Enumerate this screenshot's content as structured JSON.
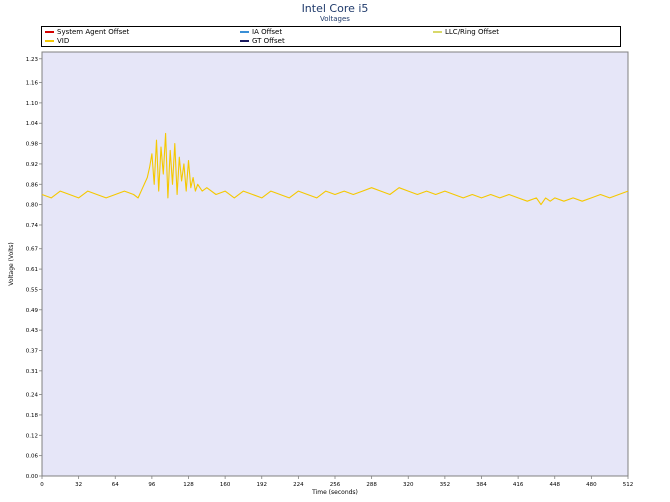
{
  "title": "Intel Core i5",
  "subtitle": "Voltages",
  "legend": [
    {
      "name": "System Agent Offset",
      "color": "#d40000"
    },
    {
      "name": "IA Offset",
      "color": "#3a8fd6"
    },
    {
      "name": "LLC/Ring Offset",
      "color": "#d8d86a"
    },
    {
      "name": "VID",
      "color": "#f5c800"
    },
    {
      "name": "GT Offset",
      "color": "#1a1a5e"
    }
  ],
  "chart_data": {
    "type": "line",
    "title": "Intel Core i5",
    "subtitle": "Voltages",
    "xlabel": "Time (seconds)",
    "ylabel": "Voltage (Volts)",
    "xlim": [
      0,
      512
    ],
    "ylim": [
      0,
      1.25
    ],
    "grid": false,
    "legend_position": "top",
    "xticks": [
      "0",
      "32",
      "64",
      "96",
      "128",
      "160",
      "192",
      "224",
      "256",
      "288",
      "320",
      "352",
      "384",
      "416",
      "448",
      "480",
      "512"
    ],
    "yticks": [
      "0.00",
      "0.06",
      "0.12",
      "0.18",
      "0.24",
      "0.31",
      "0.37",
      "0.43",
      "0.49",
      "0.55",
      "0.61",
      "0.67",
      "0.74",
      "0.80",
      "0.86",
      "0.92",
      "0.98",
      "1.04",
      "1.10",
      "1.16",
      "1.23"
    ],
    "series": [
      {
        "name": "VID",
        "color": "#f5c800",
        "x": [
          0,
          8,
          16,
          24,
          32,
          40,
          48,
          56,
          64,
          72,
          80,
          84,
          88,
          92,
          94,
          96,
          98,
          100,
          102,
          104,
          106,
          108,
          110,
          112,
          114,
          116,
          118,
          120,
          122,
          124,
          126,
          128,
          130,
          132,
          134,
          136,
          140,
          144,
          152,
          160,
          168,
          176,
          184,
          192,
          200,
          208,
          216,
          224,
          232,
          240,
          248,
          256,
          264,
          272,
          280,
          288,
          296,
          304,
          312,
          320,
          328,
          336,
          344,
          352,
          360,
          368,
          376,
          384,
          392,
          400,
          408,
          416,
          424,
          432,
          436,
          440,
          444,
          448,
          456,
          464,
          472,
          480,
          488,
          496,
          504,
          512
        ],
        "values": [
          0.83,
          0.82,
          0.84,
          0.83,
          0.82,
          0.84,
          0.83,
          0.82,
          0.83,
          0.84,
          0.83,
          0.82,
          0.85,
          0.88,
          0.91,
          0.95,
          0.86,
          0.99,
          0.84,
          0.97,
          0.89,
          1.01,
          0.82,
          0.96,
          0.86,
          0.98,
          0.83,
          0.94,
          0.87,
          0.92,
          0.84,
          0.93,
          0.85,
          0.88,
          0.84,
          0.86,
          0.84,
          0.85,
          0.83,
          0.84,
          0.82,
          0.84,
          0.83,
          0.82,
          0.84,
          0.83,
          0.82,
          0.84,
          0.83,
          0.82,
          0.84,
          0.83,
          0.84,
          0.83,
          0.84,
          0.85,
          0.84,
          0.83,
          0.85,
          0.84,
          0.83,
          0.84,
          0.83,
          0.84,
          0.83,
          0.82,
          0.83,
          0.82,
          0.83,
          0.82,
          0.83,
          0.82,
          0.81,
          0.82,
          0.8,
          0.82,
          0.81,
          0.82,
          0.81,
          0.82,
          0.81,
          0.82,
          0.83,
          0.82,
          0.83,
          0.84
        ]
      }
    ]
  }
}
